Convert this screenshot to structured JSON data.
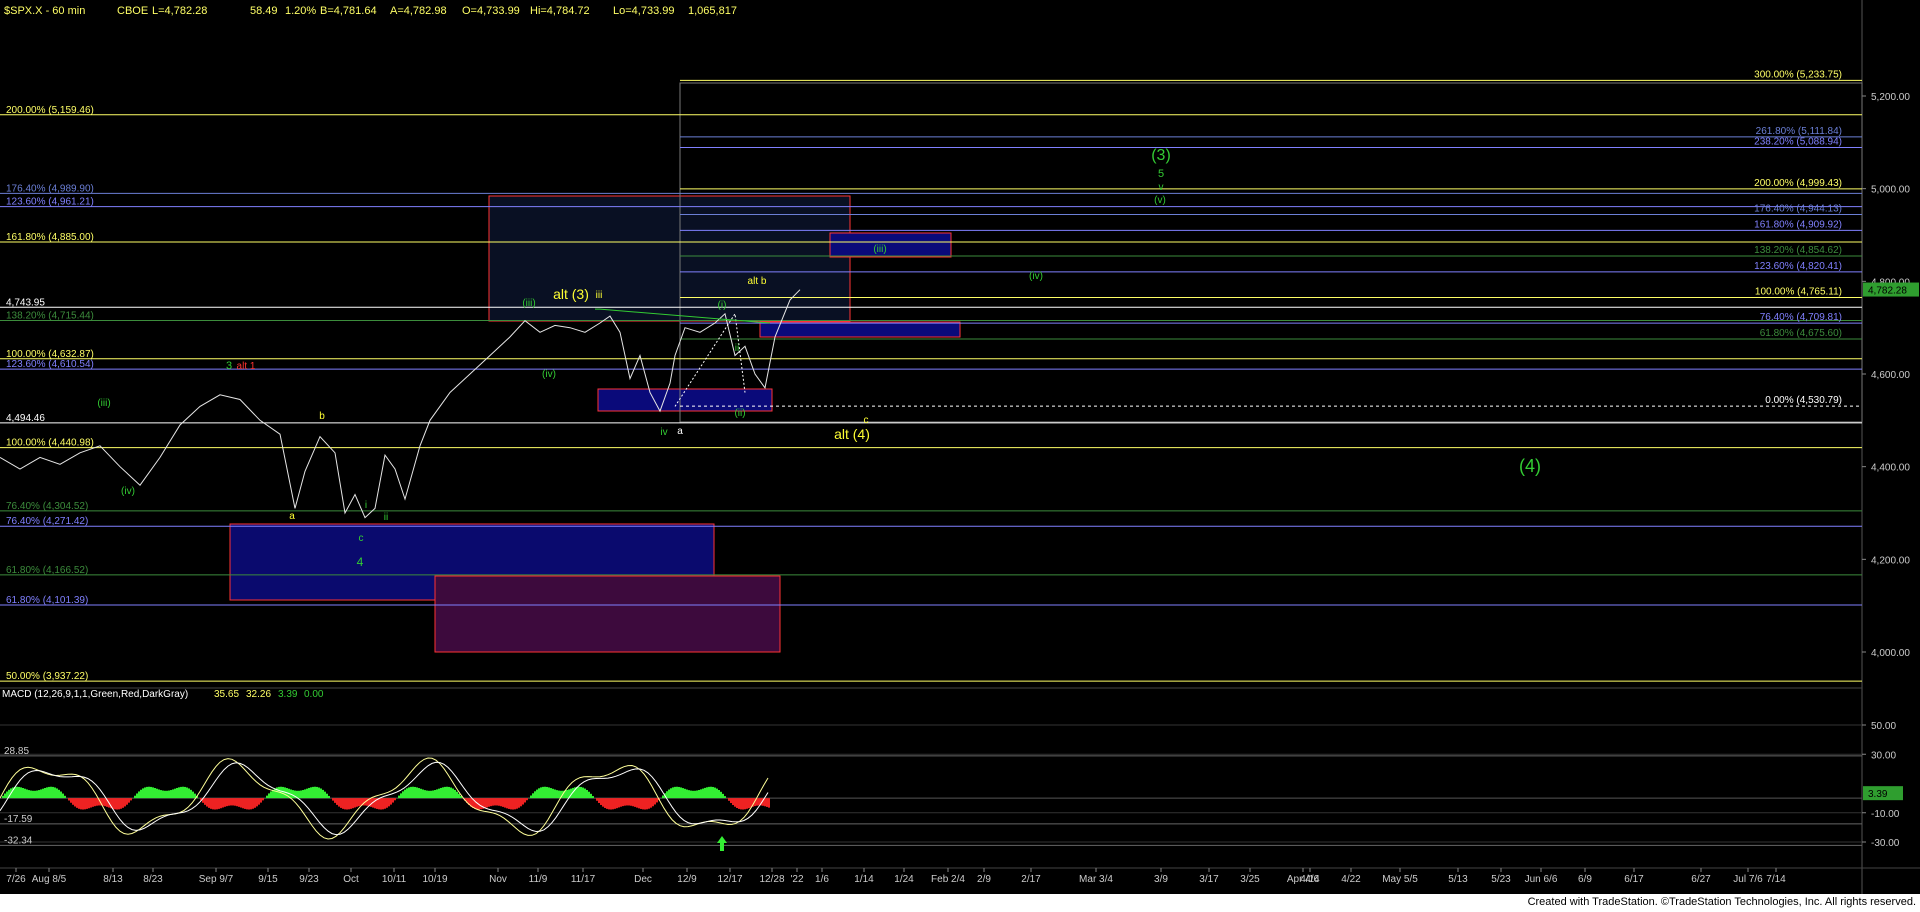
{
  "header": {
    "symbol": "$SPX.X - 60 min",
    "exchange": "CBOE",
    "last": "L=4,782.28",
    "change": "58.49",
    "change_pct": "1.20%",
    "bid": "B=4,781.64",
    "ask": "A=4,782.98",
    "open": "O=4,733.99",
    "high": "Hi=4,784.72",
    "low": "Lo=4,733.99",
    "volume": "1,065,817"
  },
  "price_axis": {
    "ticks": [
      "5,200.00",
      "5,000.00",
      "4,800.00",
      "4,600.00",
      "4,400.00",
      "4,200.00",
      "4,000.00"
    ],
    "last_price_badge": "4,782.28"
  },
  "macd": {
    "title": "MACD (12,26,9,1,1,Green,Red,DarkGray)",
    "v1": "35.65",
    "v2": "32.26",
    "v3": "3.39",
    "v4": "0.00",
    "axis_ticks": [
      "50.00",
      "30.00",
      "-10.00",
      "-30.00"
    ],
    "badge": "3.39",
    "left_labels": [
      "28.85",
      "-17.59",
      "-32.34"
    ]
  },
  "x_axis": {
    "labels": [
      "7/26",
      "Aug 8/5",
      "8/13",
      "8/23",
      "Sep 9/7",
      "9/15",
      "9/23",
      "Oct",
      "10/11",
      "10/19",
      "Nov",
      "11/9",
      "11/17",
      "Dec",
      "12/9",
      "12/17",
      "12/28",
      "'22",
      "1/6",
      "1/14",
      "1/24",
      "Feb 2/4",
      "2/9",
      "2/17",
      "Mar 3/4",
      "3/9",
      "3/17",
      "3/25",
      "Apr 4/6",
      "4/14",
      "4/22",
      "May 5/5",
      "5/13",
      "5/23",
      "Jun 6/6",
      "6/9",
      "6/17",
      "6/27",
      "Jul 7/6",
      "7/14"
    ]
  },
  "fib_levels_left": [
    {
      "label": "200.00% (5,159.46)",
      "color": "#ffff66",
      "price": 5159.46
    },
    {
      "label": "176.40% (4,989.90)",
      "color": "#6b7fd6",
      "price": 4989.9
    },
    {
      "label": "123.60% (4,961.21)",
      "color": "#8080ff",
      "price": 4961.21
    },
    {
      "label": "161.80% (4,885.00)",
      "color": "#ffff66",
      "price": 4885.0
    },
    {
      "label": "4,743.95",
      "color": "#ffffff",
      "price": 4743.95
    },
    {
      "label": "138.20% (4,715.44)",
      "color": "#3c8c3c",
      "price": 4715.44
    },
    {
      "label": "100.00% (4,632.87)",
      "color": "#ffff66",
      "price": 4632.87
    },
    {
      "label": "123.60% (4,610.54)",
      "color": "#8080ff",
      "price": 4610.54
    },
    {
      "label": "4,494.46",
      "color": "#ffffff",
      "price": 4494.46
    },
    {
      "label": "100.00% (4,440.98)",
      "color": "#ffff66",
      "price": 4440.98
    },
    {
      "label": "76.40% (4,304.52)",
      "color": "#3c8c3c",
      "price": 4304.52
    },
    {
      "label": "76.40% (4,271.42)",
      "color": "#8080ff",
      "price": 4271.42
    },
    {
      "label": "61.80% (4,166.52)",
      "color": "#3c8c3c",
      "price": 4166.52
    },
    {
      "label": "61.80% (4,101.39)",
      "color": "#8080ff",
      "price": 4101.39
    },
    {
      "label": "50.00% (3,937.22)",
      "color": "#ffff66",
      "price": 3937.22
    }
  ],
  "fib_levels_right": [
    {
      "label": "300.00% (5,233.75)",
      "color": "#ffff66",
      "price": 5233.75
    },
    {
      "label": "261.80% (5,111.84)",
      "color": "#6b7fd6",
      "price": 5111.84
    },
    {
      "label": "238.20% (5,088.94)",
      "color": "#8080ff",
      "price": 5088.94
    },
    {
      "label": "200.00% (4,999.43)",
      "color": "#ffff66",
      "price": 4999.43
    },
    {
      "label": "176.40% (4,944.13)",
      "color": "#6b7fd6",
      "price": 4944.13
    },
    {
      "label": "161.80% (4,909.92)",
      "color": "#8080ff",
      "price": 4909.92
    },
    {
      "label": "138.20% (4,854.62)",
      "color": "#3c8c3c",
      "price": 4854.62
    },
    {
      "label": "123.60% (4,820.41)",
      "color": "#8080ff",
      "price": 4820.41
    },
    {
      "label": "100.00% (4,765.11)",
      "color": "#ffff66",
      "price": 4765.11
    },
    {
      "label": "76.40% (4,709.81)",
      "color": "#8080ff",
      "price": 4709.81
    },
    {
      "label": "61.80% (4,675.60)",
      "color": "#3c8c3c",
      "price": 4675.6
    },
    {
      "label": "0.00% (4,530.79)",
      "color": "#ffffff",
      "price": 4530.79
    }
  ],
  "wave_labels": [
    {
      "text": "(3)",
      "color": "#33cc33"
    },
    {
      "text": "5",
      "color": "#33cc33"
    },
    {
      "text": "v",
      "color": "#33cc33"
    },
    {
      "text": "(v)",
      "color": "#33cc33"
    },
    {
      "text": "(iii)",
      "color": "#33cc33"
    },
    {
      "text": "(iv)",
      "color": "#33cc33"
    },
    {
      "text": "alt b",
      "color": "#ffff33"
    },
    {
      "text": "alt (3)",
      "color": "#ffff33"
    },
    {
      "text": "iii",
      "color": "#ffff33"
    },
    {
      "text": "(iii)",
      "color": "#33cc33"
    },
    {
      "text": "(i)",
      "color": "#33cc33"
    },
    {
      "text": "ii",
      "color": "#33cc33"
    },
    {
      "text": "3",
      "color": "#33cc33"
    },
    {
      "text": "alt 1",
      "color": "#ff3333"
    },
    {
      "text": "(iii)",
      "color": "#33cc33"
    },
    {
      "text": "(iv)",
      "color": "#33cc33"
    },
    {
      "text": "b",
      "color": "#ffff33"
    },
    {
      "text": "(iv)",
      "color": "#33cc33"
    },
    {
      "text": "a",
      "color": "#ffff33"
    },
    {
      "text": "i",
      "color": "#33cc33"
    },
    {
      "text": "ii",
      "color": "#33cc33"
    },
    {
      "text": "c",
      "color": "#33cc33"
    },
    {
      "text": "4",
      "color": "#33cc33"
    },
    {
      "text": "iv",
      "color": "#33cc33"
    },
    {
      "text": "a",
      "color": "#ffffff"
    },
    {
      "text": "(ii)",
      "color": "#33cc33"
    },
    {
      "text": "c",
      "color": "#ffff33"
    },
    {
      "text": "alt (4)",
      "color": "#ffff33"
    },
    {
      "text": "(4)",
      "color": "#33cc33"
    }
  ],
  "footer": "Created with TradeStation. ©TradeStation Technologies, Inc. All rights reserved."
}
